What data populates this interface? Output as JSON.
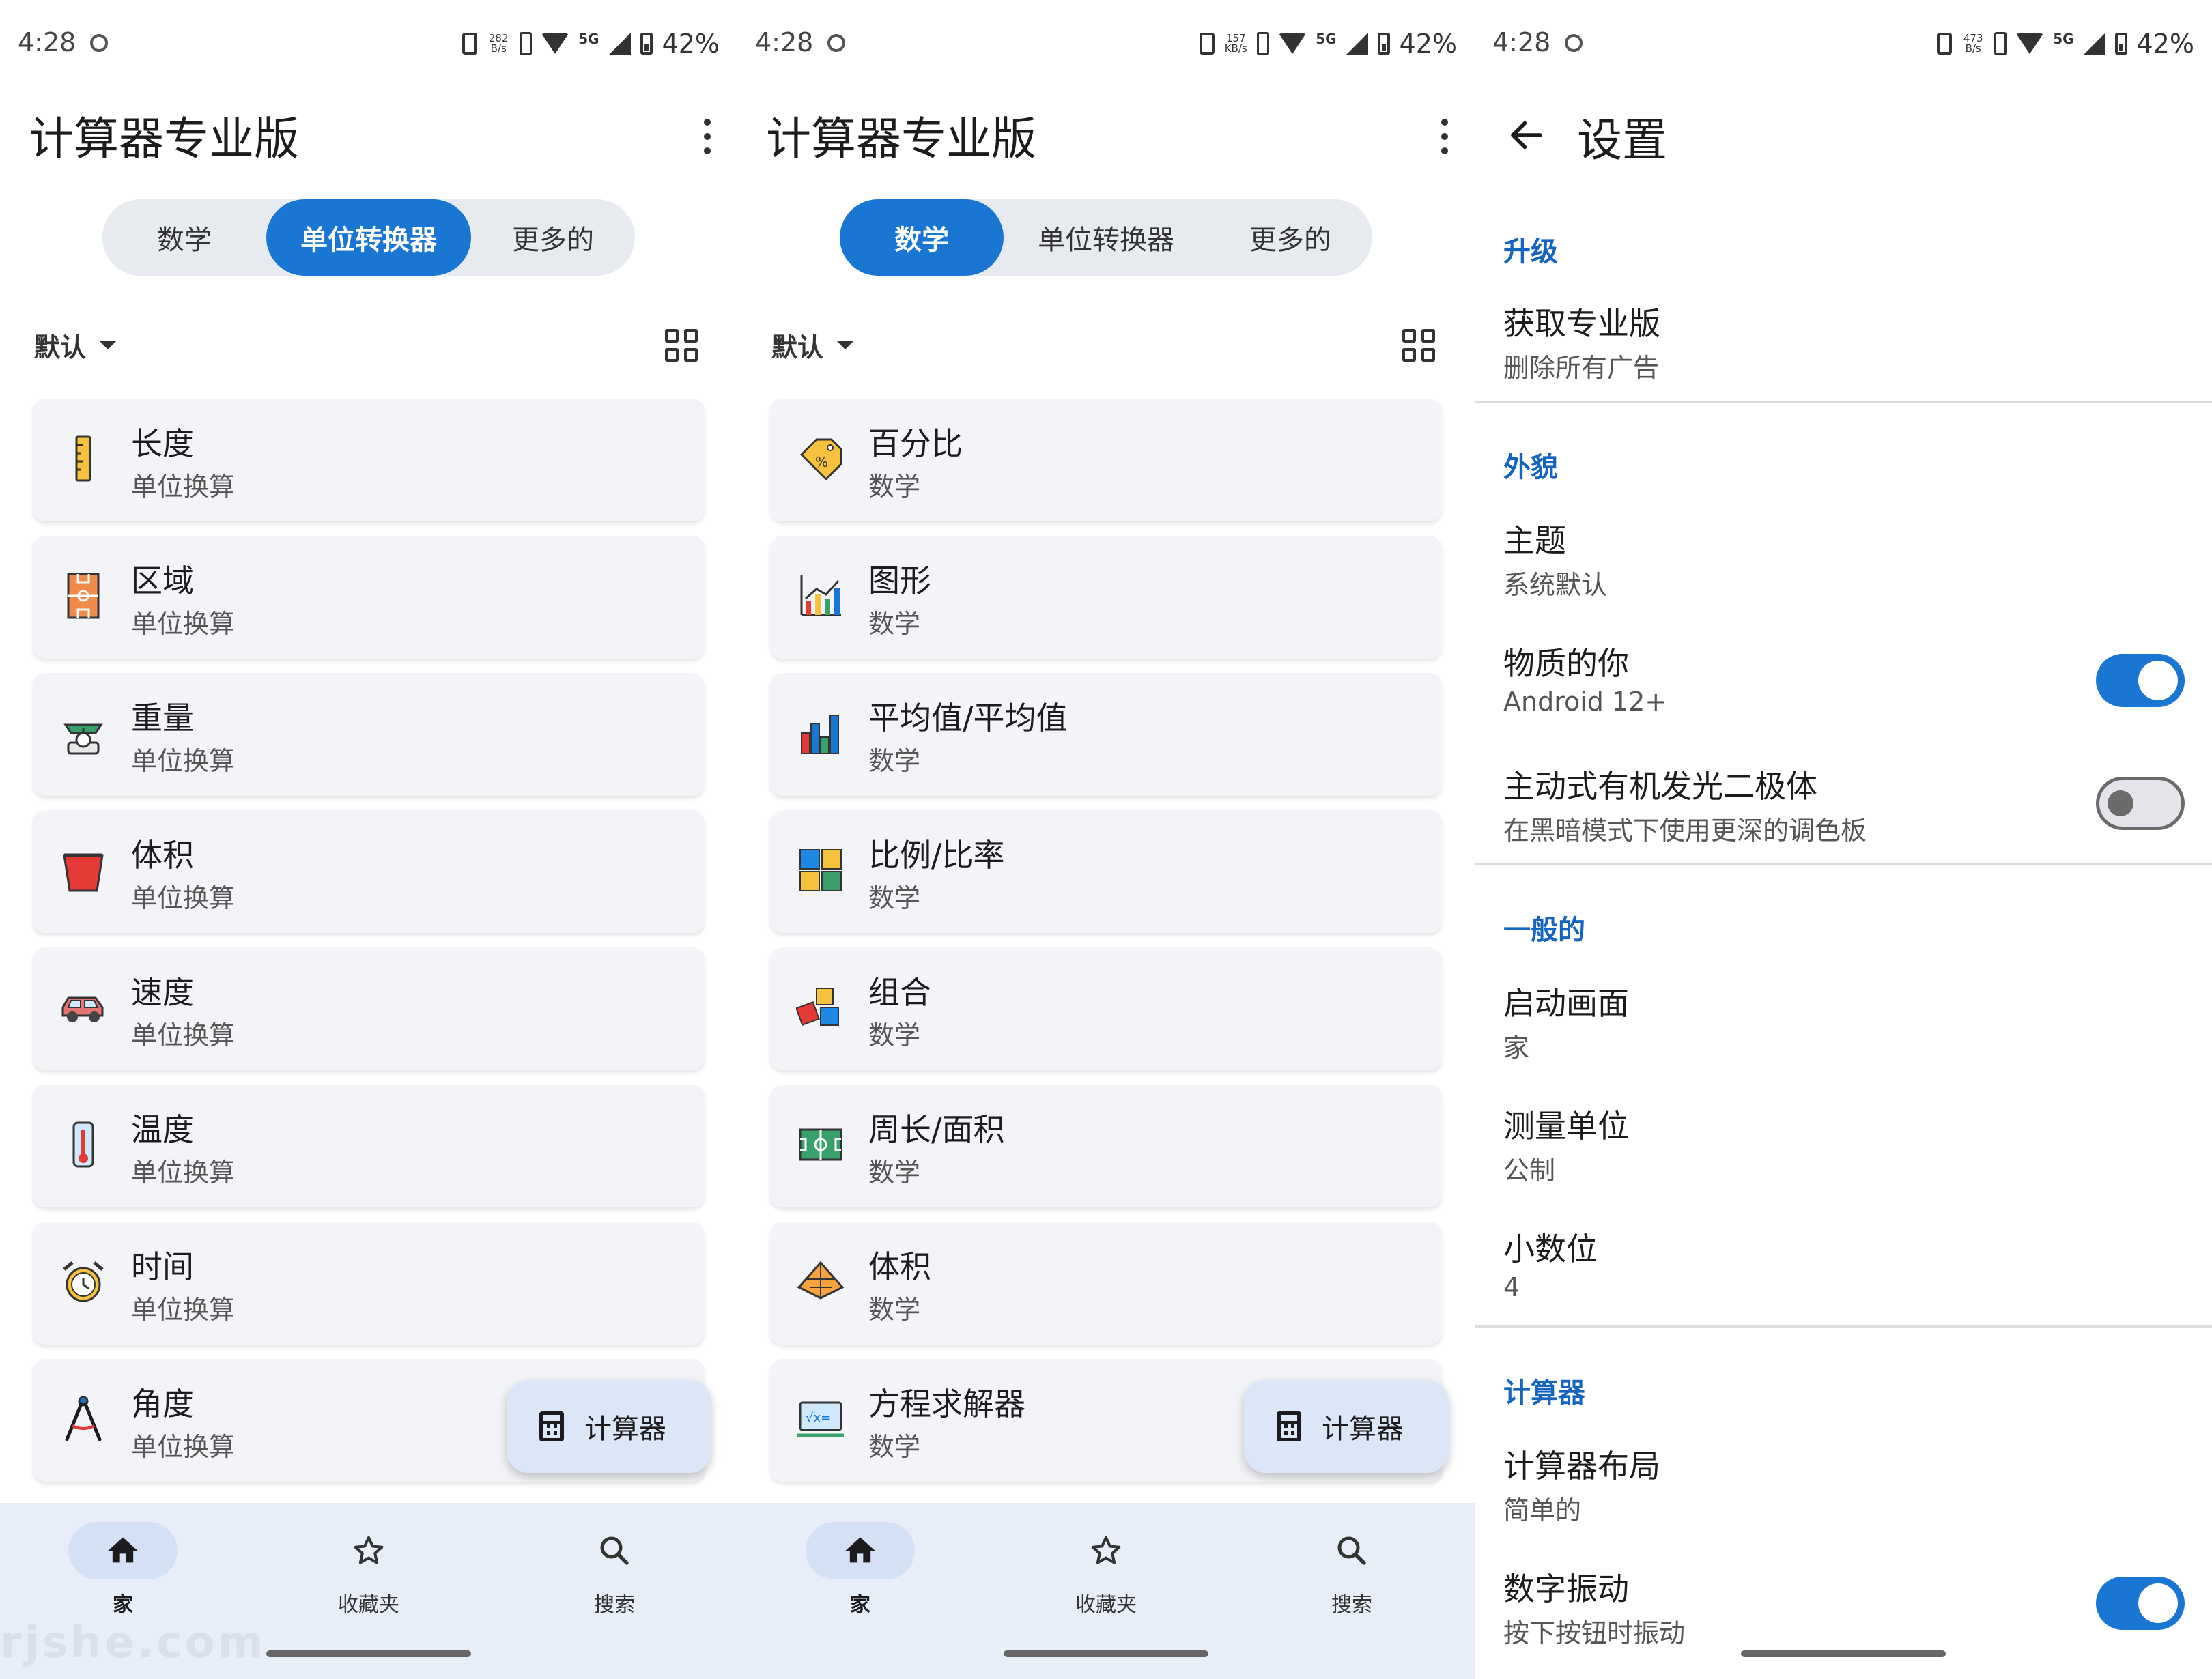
{
  "status_bar": {
    "time": "4:28",
    "speeds": [
      "282\nB/s",
      "157\nKB/s",
      "473\nB/s"
    ],
    "network": "5G",
    "battery": "42%"
  },
  "app": {
    "title": "计算器专业版",
    "accent": "#1976d2",
    "tabs": [
      "数学",
      "单位转换器",
      "更多的"
    ],
    "sort_label": "默认",
    "fab_label": "计算器",
    "nav": [
      "家",
      "收藏夹",
      "搜索"
    ],
    "watermark": "rjshe.com"
  },
  "converter_list": [
    {
      "title": "长度",
      "subtitle": "单位换算",
      "icon": "ruler-icon"
    },
    {
      "title": "区域",
      "subtitle": "单位换算",
      "icon": "field-area-icon"
    },
    {
      "title": "重量",
      "subtitle": "单位换算",
      "icon": "scale-icon"
    },
    {
      "title": "体积",
      "subtitle": "单位换算",
      "icon": "bucket-icon"
    },
    {
      "title": "速度",
      "subtitle": "单位换算",
      "icon": "car-icon"
    },
    {
      "title": "温度",
      "subtitle": "单位换算",
      "icon": "thermometer-icon"
    },
    {
      "title": "时间",
      "subtitle": "单位换算",
      "icon": "alarm-clock-icon"
    },
    {
      "title": "角度",
      "subtitle": "单位换算",
      "icon": "compass-icon"
    }
  ],
  "math_list": [
    {
      "title": "百分比",
      "subtitle": "数学",
      "icon": "percent-tag-icon"
    },
    {
      "title": "图形",
      "subtitle": "数学",
      "icon": "graph-icon"
    },
    {
      "title": "平均值/平均值",
      "subtitle": "数学",
      "icon": "bar-chart-icon"
    },
    {
      "title": "比例/比率",
      "subtitle": "数学",
      "icon": "ratio-squares-icon"
    },
    {
      "title": "组合",
      "subtitle": "数学",
      "icon": "blocks-icon"
    },
    {
      "title": "周长/面积",
      "subtitle": "数学",
      "icon": "perimeter-icon"
    },
    {
      "title": "体积",
      "subtitle": "数学",
      "icon": "pyramid-icon"
    },
    {
      "title": "方程求解器",
      "subtitle": "数学",
      "icon": "equation-icon"
    }
  ],
  "settings": {
    "title": "设置",
    "sections": [
      {
        "header": "升级",
        "rows": [
          {
            "title": "获取专业版",
            "subtitle": "删除所有广告"
          }
        ]
      },
      {
        "header": "外貌",
        "rows": [
          {
            "title": "主题",
            "subtitle": "系统默认"
          },
          {
            "title": "物质的你",
            "subtitle": "Android 12+",
            "toggle": "on"
          },
          {
            "title": "主动式有机发光二极体",
            "subtitle": "在黑暗模式下使用更深的调色板",
            "toggle": "off"
          }
        ]
      },
      {
        "header": "一般的",
        "rows": [
          {
            "title": "启动画面",
            "subtitle": "家"
          },
          {
            "title": "测量单位",
            "subtitle": "公制"
          },
          {
            "title": "小数位",
            "subtitle": "4"
          }
        ]
      },
      {
        "header": "计算器",
        "rows": [
          {
            "title": "计算器布局",
            "subtitle": "简单的"
          },
          {
            "title": "数字振动",
            "subtitle": "按下按钮时振动",
            "toggle": "on"
          }
        ]
      }
    ]
  }
}
